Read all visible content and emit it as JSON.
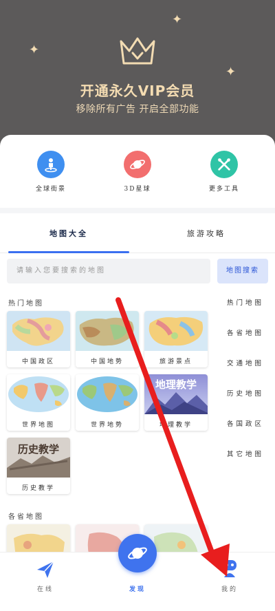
{
  "vip": {
    "title": "开通永久VIP会员",
    "subtitle": "移除所有广告 开启全部功能",
    "accent": "#f4dcb2",
    "background": "#5c5a5a"
  },
  "quick_actions": [
    {
      "label": "全球街景",
      "icon": "street-view-icon",
      "color": "#3f8ff0"
    },
    {
      "label": "3D星球",
      "icon": "planet-icon",
      "color": "#f26e6e"
    },
    {
      "label": "更多工具",
      "icon": "tools-icon",
      "color": "#2fc4a6"
    }
  ],
  "tabs": [
    {
      "label": "地图大全",
      "active": true
    },
    {
      "label": "旅游攻略",
      "active": false
    }
  ],
  "search": {
    "placeholder": "请输入您要搜索的地图",
    "button": "地图搜索"
  },
  "sections": {
    "hot": "热门地图",
    "province": "各省地图"
  },
  "cards": [
    {
      "label": "中国政区",
      "thumb": "china-political-map"
    },
    {
      "label": "中国地势",
      "thumb": "china-terrain-map"
    },
    {
      "label": "旅游景点",
      "thumb": "tourist-attractions-map"
    },
    {
      "label": "世界地图",
      "thumb": "world-map"
    },
    {
      "label": "世界地势",
      "thumb": "world-terrain-map"
    },
    {
      "label": "地理教学",
      "thumb": "geography-teaching",
      "thumb_text": "地理教学"
    },
    {
      "label": "历史教学",
      "thumb": "history-teaching",
      "thumb_text": "历史教学"
    }
  ],
  "side_menu": [
    "热门地图",
    "各省地图",
    "交通地图",
    "历史地图",
    "各国政区",
    "其它地图"
  ],
  "nav": {
    "left": {
      "label": "在线",
      "icon": "paper-plane-icon"
    },
    "center": {
      "label": "发现",
      "icon": "planet-icon"
    },
    "right": {
      "label": "我的",
      "icon": "user-robot-icon"
    }
  },
  "colors": {
    "primary": "#3f73ee",
    "annotation": "#e81e1e"
  }
}
